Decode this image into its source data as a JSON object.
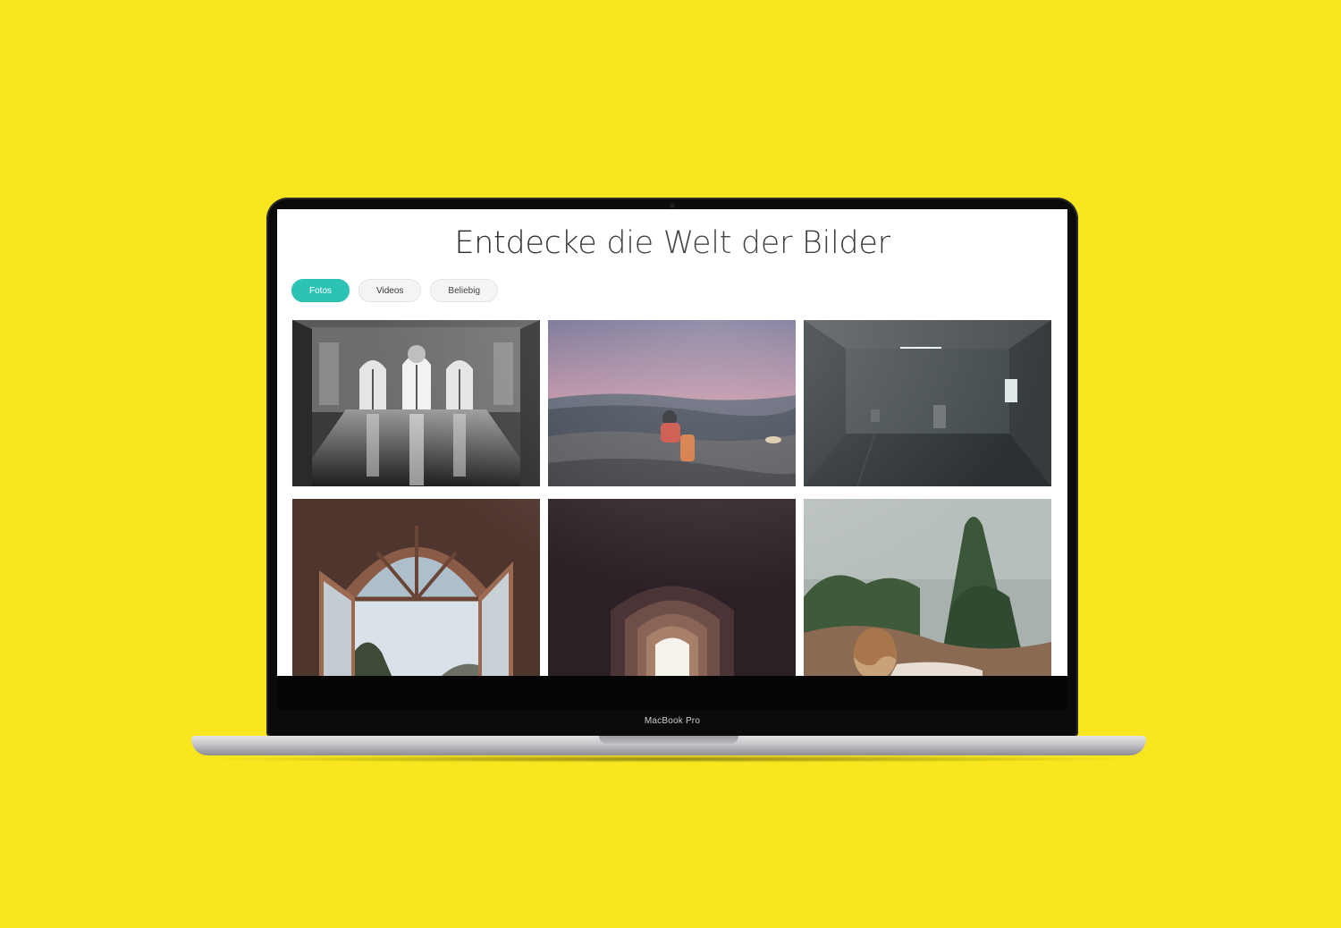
{
  "page": {
    "title": "Entdecke die Welt der Bilder"
  },
  "filters": [
    {
      "label": "Fotos",
      "active": true
    },
    {
      "label": "Videos",
      "active": false
    },
    {
      "label": "Beliebig",
      "active": false
    }
  ],
  "device": {
    "label": "MacBook Pro"
  },
  "colors": {
    "background": "#F8E71E",
    "accent": "#2CC2B4"
  },
  "gallery": {
    "images": [
      {
        "subject": "ballroom-photo"
      },
      {
        "subject": "mountain-sunset-photo"
      },
      {
        "subject": "empty-room-photo"
      },
      {
        "subject": "arched-window-photo"
      },
      {
        "subject": "archway-photo"
      },
      {
        "subject": "woman-in-field-photo"
      }
    ]
  }
}
